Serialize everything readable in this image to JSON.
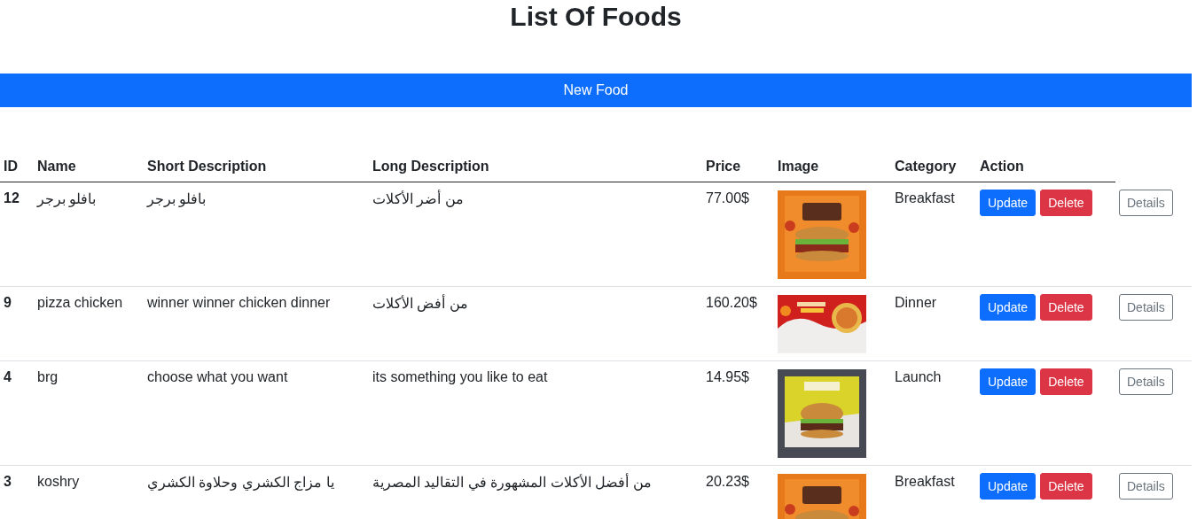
{
  "page_title": "List Of Foods",
  "new_button": "New Food",
  "table": {
    "columns": [
      "ID",
      "Name",
      "Short Description",
      "Long Description",
      "Price",
      "Image",
      "Category",
      "Action"
    ],
    "rows": [
      {
        "id": "12",
        "name": "بافلو برجر",
        "short_description": "بافلو برجر",
        "long_description": "من أضر الأكلات",
        "price": "77.00$",
        "image": {
          "kind": "picture"
        },
        "category": "Breakfast",
        "actions": [
          "Update",
          "Delete",
          "Details"
        ]
      },
      {
        "id": "9",
        "name": "pizza chicken",
        "short_description": "winner winner chicken dinner",
        "long_description": "من أفض الأكلات",
        "price": "160.20$",
        "image": {
          "kind": "picture"
        },
        "category": "Dinner",
        "actions": [
          "Update",
          "Delete",
          "Details"
        ]
      },
      {
        "id": "4",
        "name": "brg",
        "short_description": "choose what you want",
        "long_description": "its something you like to eat",
        "price": "14.95$",
        "image": {
          "kind": "picture"
        },
        "category": "Launch",
        "actions": [
          "Update",
          "Delete",
          "Details"
        ]
      },
      {
        "id": "3",
        "name": "koshry",
        "short_description": "يا مزاج الكشري وحلاوة الكشري",
        "long_description": "من أفضل الأكلات المشهورة في التقاليد المصرية",
        "price": "20.23$",
        "image": {
          "kind": "picture"
        },
        "category": "Breakfast",
        "actions": [
          "Update",
          "Delete",
          "Details"
        ]
      }
    ]
  }
}
